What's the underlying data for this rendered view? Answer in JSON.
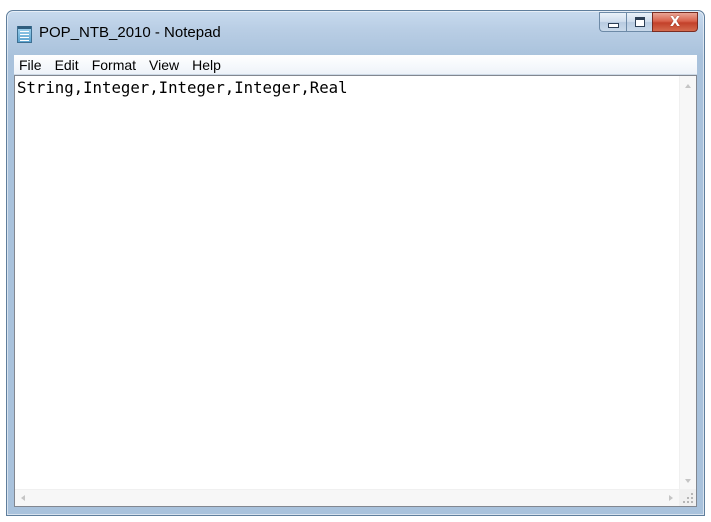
{
  "window": {
    "title": "POP_NTB_2010 - Notepad",
    "close_glyph": "X"
  },
  "menubar": {
    "items": [
      "File",
      "Edit",
      "Format",
      "View",
      "Help"
    ]
  },
  "editor": {
    "content": "String,Integer,Integer,Integer,Real"
  },
  "icons": {
    "app": "notepad-icon",
    "minimize": "minimize-icon",
    "maximize": "maximize-icon",
    "close": "close-icon",
    "scroll_up": "scroll-up-arrow-icon",
    "scroll_down": "scroll-down-arrow-icon",
    "scroll_left": "scroll-left-arrow-icon",
    "scroll_right": "scroll-right-arrow-icon",
    "resize": "resize-grip-icon"
  },
  "colors": {
    "frame": "#a9c2dc",
    "close_button": "#c3412a",
    "editor_background": "#ffffff"
  }
}
